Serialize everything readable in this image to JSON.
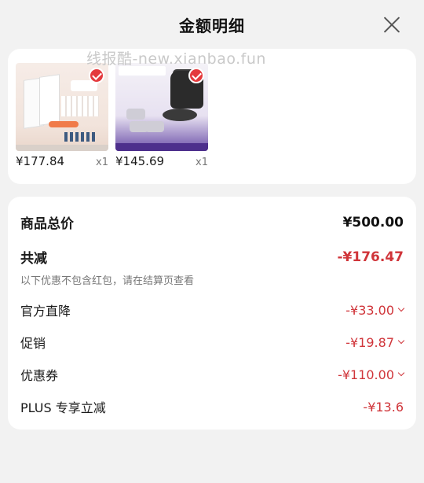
{
  "header": {
    "title": "金额明细"
  },
  "watermark": "线报酷-new.xianbao.fun",
  "products": [
    {
      "price": "¥177.84",
      "qty": "x1",
      "selected": true
    },
    {
      "price": "¥145.69",
      "qty": "x1",
      "selected": true
    }
  ],
  "summary": {
    "total": {
      "label": "商品总价",
      "value": "¥500.00"
    },
    "discount_total": {
      "label": "共减",
      "value": "-¥176.47"
    },
    "note": "以下优惠不包含红包，请在结算页查看",
    "items": [
      {
        "label": "官方直降",
        "value": "-¥33.00"
      },
      {
        "label": "促销",
        "value": "-¥19.87"
      },
      {
        "label": "优惠券",
        "value": "-¥110.00"
      },
      {
        "label": "PLUS 专享立减",
        "value": "-¥13.6"
      }
    ]
  },
  "colors": {
    "accent": "#e4393c",
    "discount_text": "#d0353a"
  }
}
